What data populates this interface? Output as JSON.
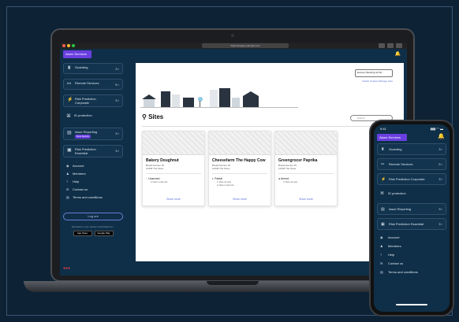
{
  "browser": {
    "url": "https://myapp.example.com"
  },
  "app": {
    "brand": "Alarm Services"
  },
  "sidebar": {
    "items": [
      {
        "icon": "guard-icon",
        "label": "Guarding",
        "count": "3 ›"
      },
      {
        "icon": "remote-icon",
        "label": "Remote Services",
        "count": "5 ›"
      },
      {
        "icon": "risk-icon",
        "label": "Risk Prediction Corporate",
        "count": "3 ›"
      },
      {
        "icon": "id-icon",
        "label": "ID protection",
        "count": ""
      },
      {
        "icon": "report-icon",
        "label": "Issue Reporting",
        "badge": "New feature",
        "count": "3 ›"
      },
      {
        "icon": "risk-icon",
        "label": "Risk Prediction Essential",
        "count": "3 ›"
      }
    ],
    "links": [
      {
        "icon": "account-icon",
        "label": "Account"
      },
      {
        "icon": "members-icon",
        "label": "Members"
      },
      {
        "icon": "help-icon",
        "label": "Help"
      },
      {
        "icon": "contact-icon",
        "label": "Contact us"
      },
      {
        "icon": "terms-icon",
        "label": "Terms and conditions"
      }
    ],
    "logout": "Log out",
    "store_text": "Securitas in your pocket. Download our...",
    "app_store": "App Store",
    "google_play": "Google Play"
  },
  "main": {
    "location_label": "Europe (Sterling) 22 All...",
    "location_links": "Switch location   Manage sites",
    "title": "Sites",
    "search_placeholder": "Search",
    "cards": [
      {
        "name": "Bakery Doughnut",
        "addr1": "Bread Avenue 15",
        "addr2": "12345 The Store",
        "status": "Unarmed",
        "sub": "2 sites unarmed",
        "show": "Show more"
      },
      {
        "name": "Cheesefarm The Happy Cow",
        "addr1": "Bread Avenue 15",
        "addr2": "12345 The Store",
        "status": "Partial",
        "sub": "1 sites armed",
        "sub2": "2 sites unarmed",
        "show": "Show more"
      },
      {
        "name": "Greengrocer Paprika",
        "addr1": "Bread Avenue 15",
        "addr2": "12345 The Store",
        "status": "Armed",
        "sub": "2 sites armed",
        "show": "Show more"
      }
    ]
  },
  "footer": {
    "logo": "●●●",
    "text": "Find more Securitas services"
  },
  "phone": {
    "time": "9:41",
    "signal": "▮▮▮ ◠ ▬",
    "brand": "Alarm Services",
    "items": [
      {
        "icon": "guard-icon",
        "label": "Guarding",
        "count": "3 ›"
      },
      {
        "icon": "remote-icon",
        "label": "Remote Services",
        "count": "5 ›"
      },
      {
        "icon": "risk-icon",
        "label": "Risk Prediction Corporate",
        "count": "3 ›"
      },
      {
        "icon": "id-icon",
        "label": "ID protection",
        "count": ""
      },
      {
        "icon": "report-icon",
        "label": "Issue Reporting",
        "count": "3 ›"
      },
      {
        "icon": "risk-icon",
        "label": "Risk Prediction Essential",
        "count": "3 ›"
      }
    ],
    "links": [
      {
        "icon": "account-icon",
        "label": "Account"
      },
      {
        "icon": "members-icon",
        "label": "Members"
      },
      {
        "icon": "help-icon",
        "label": "Help"
      },
      {
        "icon": "contact-icon",
        "label": "Contact us"
      },
      {
        "icon": "terms-icon",
        "label": "Terms and conditions"
      }
    ]
  },
  "colors": {
    "accent": "#6a3fe0",
    "background": "#0d2235",
    "panel": "#0f2f48",
    "alert": "#e53a4a"
  }
}
